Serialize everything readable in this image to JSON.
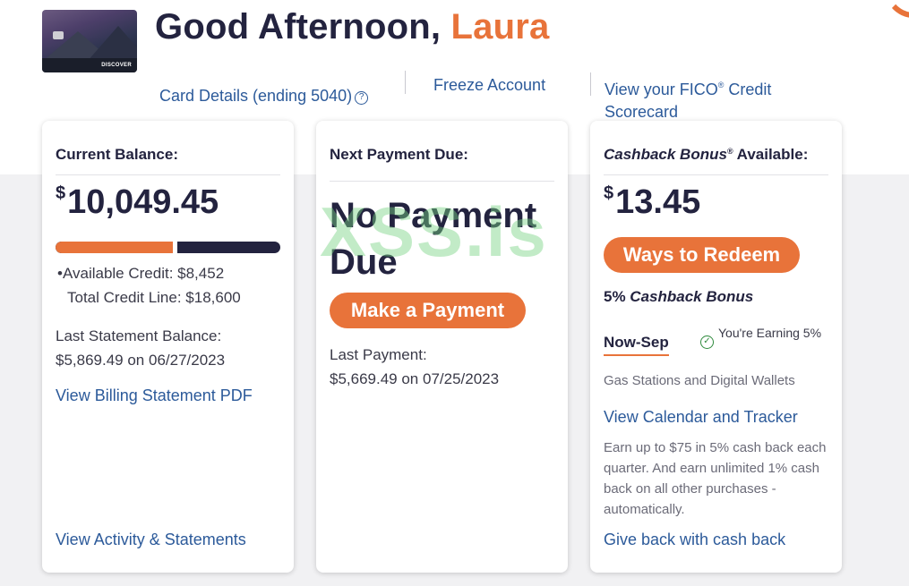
{
  "header": {
    "greeting": "Good Afternoon, ",
    "user_name": "Laura",
    "card_brand": "DISCOVER",
    "links": {
      "card_details": "Card Details (ending 5040)",
      "help_glyph": "?",
      "freeze": "Freeze Account",
      "fico_prefix": "View your FICO",
      "fico_reg": "®",
      "fico_suffix": " Credit Scorecard"
    }
  },
  "balance_panel": {
    "title": "Current Balance:",
    "currency": "$",
    "amount": "10,049.45",
    "utilization_fraction": 0.54,
    "available_credit": "•Available Credit: $8,452",
    "total_credit_line": "Total Credit Line: $18,600",
    "last_statement_label": "Last Statement Balance:",
    "last_statement_value": "$5,869.49 on 06/27/2023",
    "billing_link": "View Billing Statement PDF",
    "activity_link": "View Activity & Statements"
  },
  "payment_panel": {
    "title": "Next Payment Due:",
    "status": "No Payment Due",
    "button": "Make a Payment",
    "last_payment_label": "Last Payment:",
    "last_payment_value": "$5,669.49 on 07/25/2023"
  },
  "cashback_panel": {
    "title_italic": "Cashback Bonus",
    "title_reg": "®",
    "title_suffix": " Available:",
    "currency": "$",
    "amount": "13.45",
    "button": "Ways to Redeem",
    "bonus_prefix": "5% ",
    "bonus_italic": "Cashback Bonus",
    "period": "Now-Sep",
    "earning_glyph": "✓",
    "earning_text": "You're Earning 5%",
    "category": "Gas Stations and Digital Wallets",
    "calendar_link": "View Calendar and Tracker",
    "fine_print": "Earn up to $75 in 5% cash back each quarter. And earn unlimited 1% cash back on all other purchases - automatically.",
    "give_back_link": "Give back with cash back"
  },
  "watermark": "XSS.is",
  "colors": {
    "accent_orange": "#e8733a",
    "navy": "#23233f",
    "link_blue": "#2c5a9a",
    "success_green": "#2f8a3d"
  }
}
